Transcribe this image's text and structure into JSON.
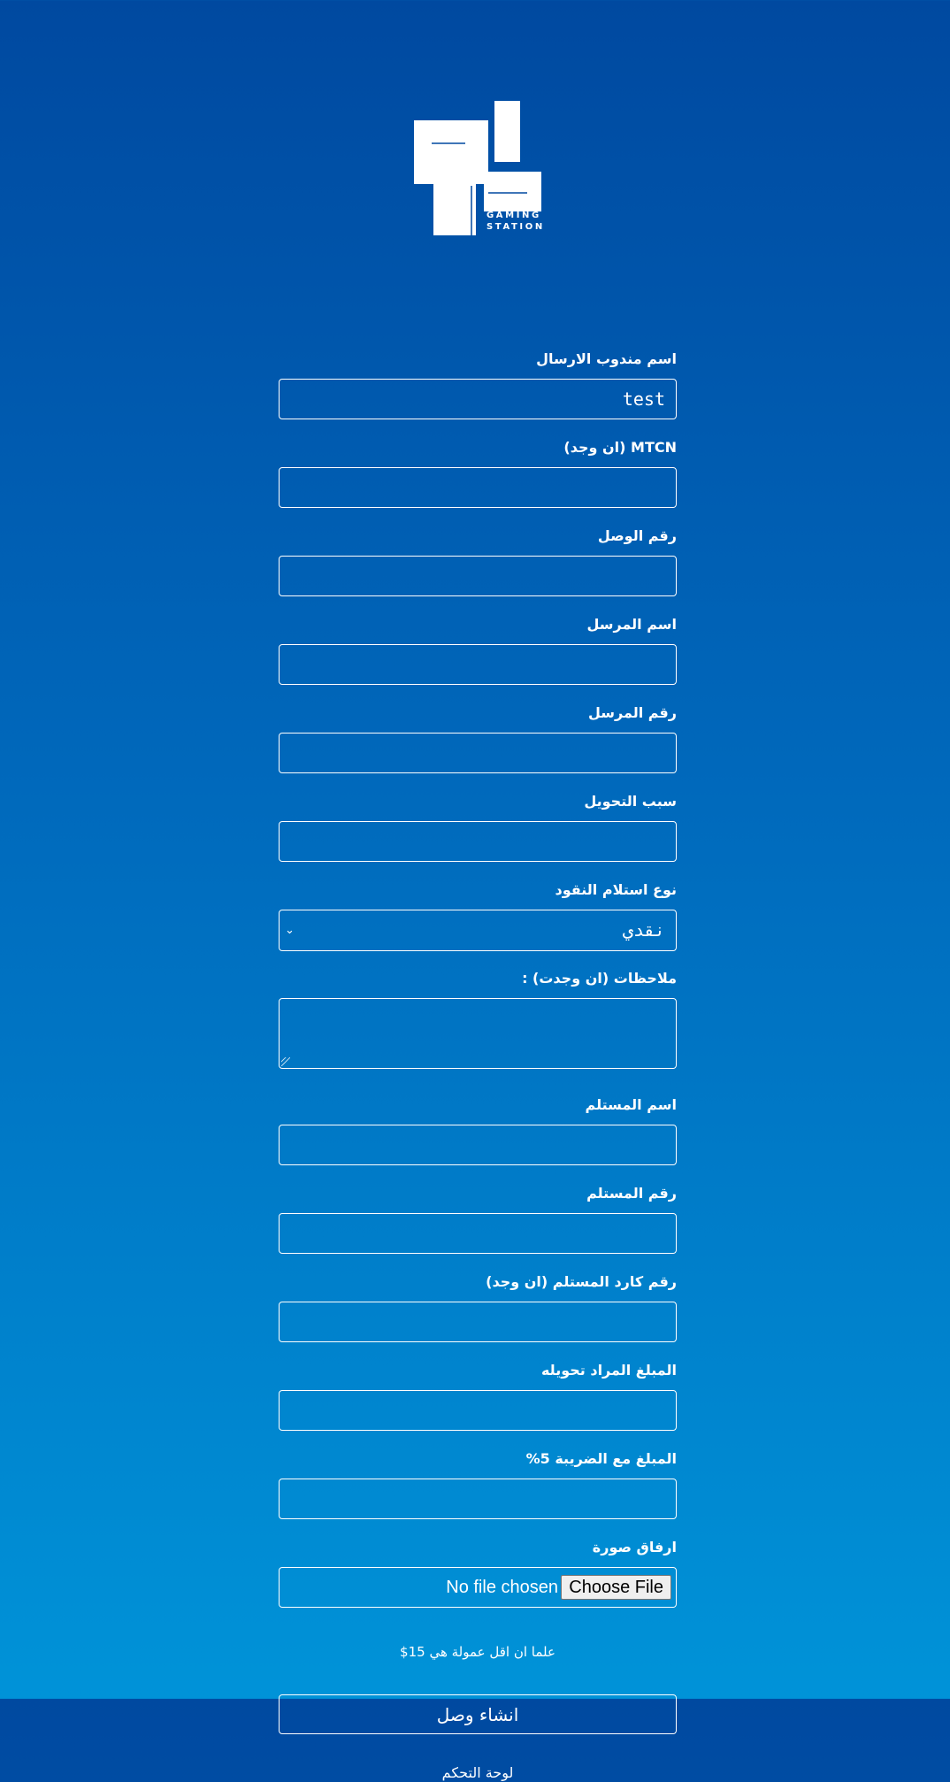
{
  "logo": {
    "alt": "GAMING STATION",
    "line1": "GAMING",
    "line2": "STATION"
  },
  "form": {
    "fields": [
      {
        "label": "اسم مندوب الارسال",
        "value": "test",
        "placeholder": ""
      },
      {
        "label": "MTCN (ان وجد)",
        "value": "",
        "placeholder": ""
      },
      {
        "label": "رقم الوصل",
        "value": "",
        "placeholder": ""
      },
      {
        "label": "اسم المرسل",
        "value": "",
        "placeholder": ""
      },
      {
        "label": "رقم المرسل",
        "value": "",
        "placeholder": ""
      },
      {
        "label": "سبب التحويل",
        "value": "",
        "placeholder": ""
      }
    ],
    "money_type": {
      "label": "نوع استلام النقود",
      "selected": "نقدي"
    },
    "notes": {
      "label": "ملاحظات (ان وجدت) :",
      "value": ""
    },
    "fields2": [
      {
        "label": "اسم المستلم",
        "value": "",
        "placeholder": ""
      },
      {
        "label": "رقم المستلم",
        "value": "",
        "placeholder": ""
      },
      {
        "label": "رقم كارد المستلم (ان وجد)",
        "value": "",
        "placeholder": ""
      },
      {
        "label": "المبلغ المراد تحويله",
        "value": "",
        "placeholder": ""
      },
      {
        "label": "المبلغ مع الضريبة 5%",
        "value": "",
        "placeholder": ""
      }
    ],
    "attachment": {
      "label": "ارفاق صورة",
      "button_label": "Choose File",
      "status": "No file chosen"
    },
    "note": "علما ان اقل عمولة هي 15$",
    "submit_label": "انشاء وصل",
    "dashboard_link": "لوحة التحكم"
  }
}
